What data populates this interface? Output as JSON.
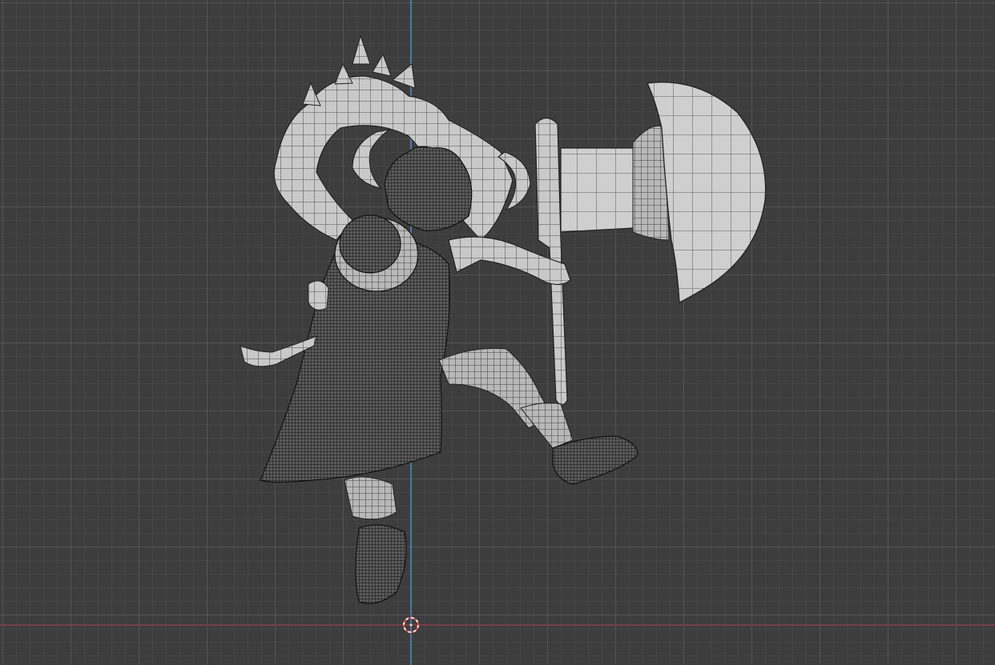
{
  "viewport": {
    "mode": "wireframe-overlay",
    "background": "#3d3d3d",
    "grid_color": "#4a4a4a",
    "axis_x_color": "#7a3c46",
    "axis_z_color": "#4a78a8"
  },
  "model": {
    "parts": [
      "arms",
      "horns",
      "hair",
      "hat",
      "cape",
      "legs",
      "boots",
      "axe"
    ],
    "surface_color": "#c8c8c8",
    "wire_color": "#1a1a1a"
  },
  "cursor": {
    "icon": "3d-cursor-icon",
    "ring_colors": [
      "#e04848",
      "#ffffff"
    ]
  }
}
